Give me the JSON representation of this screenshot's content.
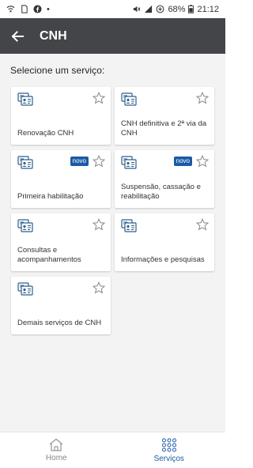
{
  "status_bar": {
    "battery": "68%",
    "time": "21:12"
  },
  "appbar": {
    "title": "CNH"
  },
  "main": {
    "section_title": "Selecione um serviço:",
    "cards": [
      {
        "label": "Renovação CNH",
        "badge": ""
      },
      {
        "label": "CNH definitiva e 2ª via da CNH",
        "badge": ""
      },
      {
        "label": "Primeira habilitação",
        "badge": "novo"
      },
      {
        "label": "Suspensão, cassação e reabilitação",
        "badge": "novo"
      },
      {
        "label": "Consultas e acompanhamentos",
        "badge": ""
      },
      {
        "label": "Informações e pesquisas",
        "badge": ""
      },
      {
        "label": "Demais serviços de CNH",
        "badge": ""
      }
    ]
  },
  "bottom_nav": {
    "home_label": "Home",
    "services_label": "Serviços"
  },
  "colors": {
    "appbar": "#444549",
    "accent": "#1b5aa6",
    "icon": "#2e5f8a",
    "background": "#f3f3f3"
  }
}
